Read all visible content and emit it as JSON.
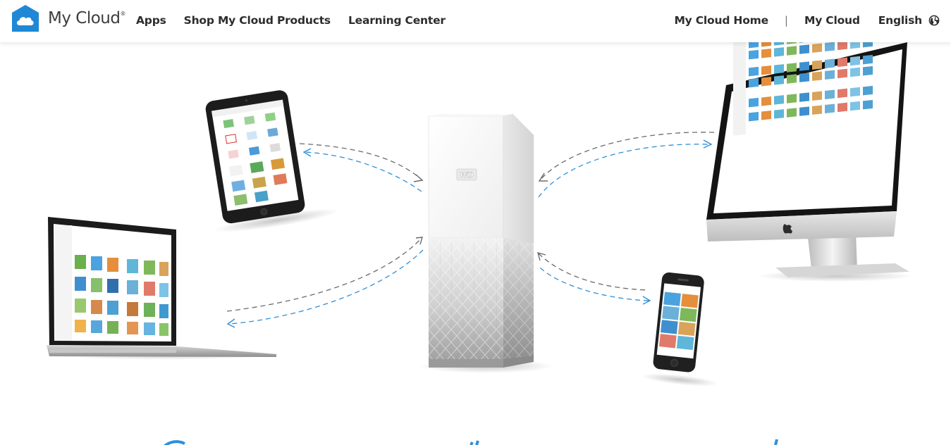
{
  "header": {
    "logo_text": "My Cloud",
    "logo_reg": "®",
    "nav_left": [
      {
        "label": "Apps"
      },
      {
        "label": "Shop My Cloud Products"
      },
      {
        "label": "Learning Center"
      }
    ],
    "nav_right": {
      "home_link": "My Cloud Home",
      "separator": "|",
      "cloud_link": "My Cloud",
      "language": "English"
    }
  },
  "colors": {
    "brand_blue": "#1e88d6",
    "arrow_blue": "#2f8fd8",
    "arrow_gray": "#6b6b6b"
  },
  "icons": {
    "logo": "cloud-house-icon",
    "language": "globe-icon"
  }
}
